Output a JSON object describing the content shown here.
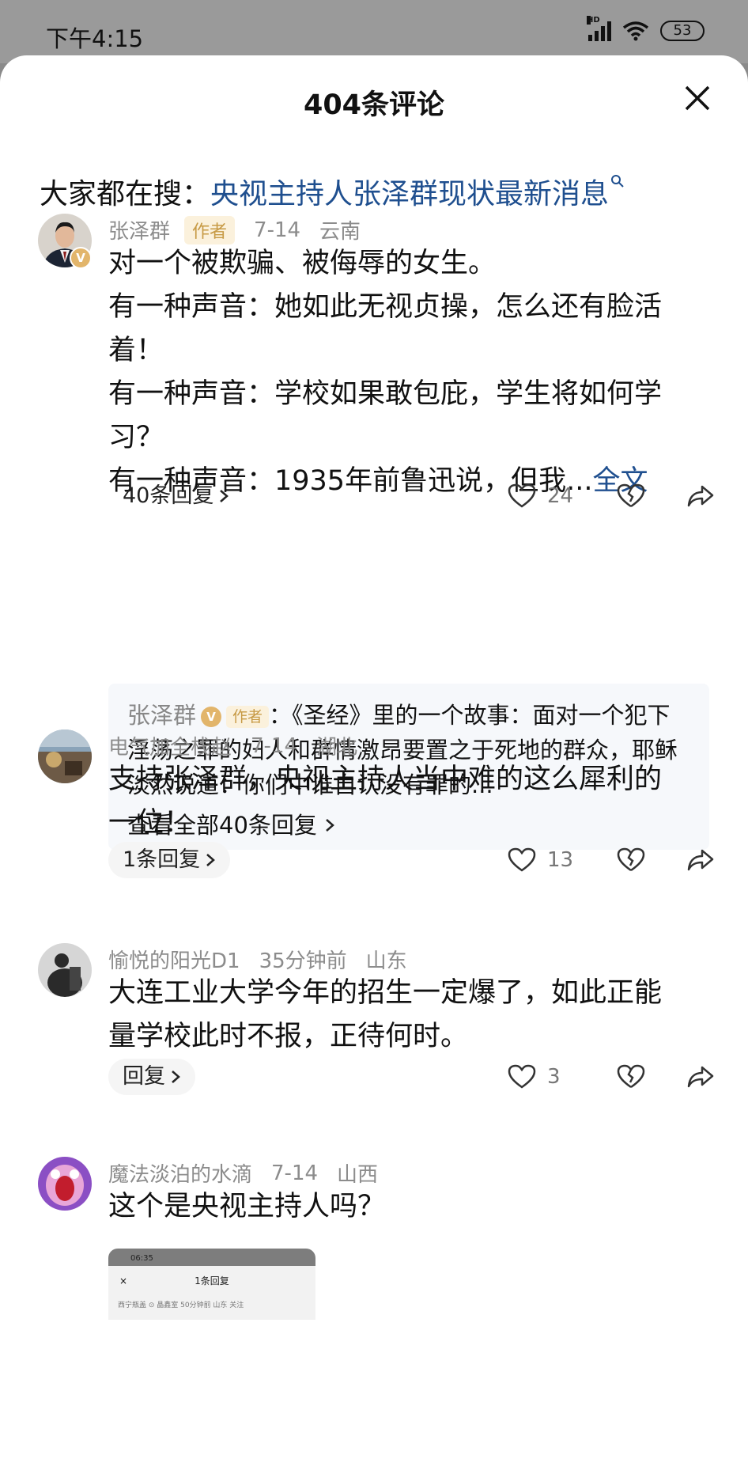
{
  "status": {
    "time": "下午4:15",
    "net": "HD",
    "battery": "53"
  },
  "sheet": {
    "title": "404条评论"
  },
  "search": {
    "prefix": "大家都在搜：",
    "query": "央视主持人张泽群现状最新消息"
  },
  "comments": [
    {
      "user": "张泽群",
      "badge": "作者",
      "date": "7-14",
      "location": "云南",
      "lines": [
        "对一个被欺骗、被侮辱的女生。",
        "有一种声音：她如此无视贞操，怎么还有脸活",
        "着！",
        "有一种声音：学校如果敢包庇，学生将如何学",
        "习？",
        "有一种声音：1935年前鲁迅说，但我..."
      ],
      "more": "全文",
      "reply_label": "40条回复",
      "likes": "24",
      "sub_reply": {
        "name": "张泽群",
        "badge": "作者",
        "text": "：《圣经》里的一个故事：面对一个犯下淫荡之罪的妇人和群情激昂要置之于死地的群众，耶稣淡然说道：你们中谁自认没有罪的...",
        "view_all": "查看全部40条回复"
      }
    },
    {
      "user": "电气加全栈赵",
      "date": "7-14",
      "location": "湖北",
      "lines": [
        "支持张泽群，央视主持人当中难的这么犀利的",
        "一位！"
      ],
      "reply_label": "1条回复",
      "likes": "13"
    },
    {
      "user": "愉悦的阳光D1",
      "date": "35分钟前",
      "location": "山东",
      "lines": [
        "大连工业大学今年的招生一定爆了，如此正能",
        "量学校此时不报，正待何时。"
      ],
      "reply_label": "回复",
      "likes": "3"
    },
    {
      "user": "魔法淡泊的水滴",
      "date": "7-14",
      "location": "山西",
      "lines": [
        "这个是央视主持人吗？"
      ],
      "thumb": {
        "time": "06:35",
        "title": "1条回复",
        "close": "×",
        "meta": "西宁瓶盖 ⊙ 晶鑫室 50分钟前 山东    关注"
      }
    }
  ]
}
